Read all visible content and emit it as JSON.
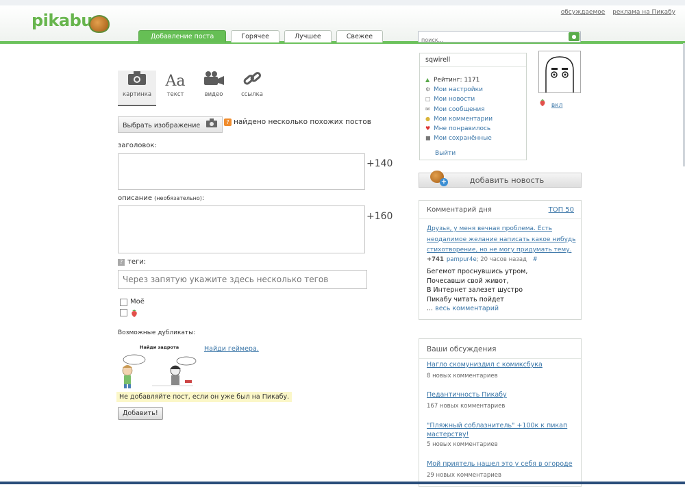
{
  "header": {
    "logo_text": "pikabu",
    "top_links": [
      "обсуждаемое",
      "реклама на Пикабу"
    ],
    "tabs": [
      "Добавление поста",
      "Горячее",
      "Лучшее",
      "Свежее"
    ],
    "search_placeholder": "поиск..."
  },
  "post_form": {
    "type_tabs": [
      {
        "label": "картинка",
        "icon": "camera-icon"
      },
      {
        "label": "текст",
        "icon": "text-icon"
      },
      {
        "label": "видео",
        "icon": "video-camera-icon"
      },
      {
        "label": "ссылка",
        "icon": "link-icon"
      }
    ],
    "choose_image_label": "Выбрать изображение",
    "similar_found": "найдено несколько похожих постов",
    "title_label": "заголовок:",
    "title_counter": "+140",
    "description_label": "описание",
    "description_optional": "(необязательно)",
    "description_colon": ":",
    "description_counter": "+160",
    "tags_label": "теги:",
    "tags_placeholder": "Через запятую укажите здесь несколько тегов",
    "checkbox_mine_label": "Моё",
    "duplicates_label": "Возможные дубликаты:",
    "duplicate_link": "Найди геймера.",
    "comic_caption": "Найди задрота",
    "warning": "Не добавляйте пост, если он уже был на Пикабу.",
    "submit_label": "Добавить!"
  },
  "user": {
    "username": "sqwirell",
    "menu": [
      {
        "icon": "rating-icon",
        "label": "Рейтинг: 1171"
      },
      {
        "icon": "settings-icon",
        "label": "Мои настройки"
      },
      {
        "icon": "news-icon",
        "label": "Мои новости"
      },
      {
        "icon": "mail-icon",
        "label": "Мои сообщения"
      },
      {
        "icon": "comment-icon",
        "label": "Мои комментарии"
      },
      {
        "icon": "heart-icon",
        "label": "Мне понравилось"
      },
      {
        "icon": "save-icon",
        "label": "Мои сохранённые"
      }
    ],
    "logout": "Выйти",
    "strawberry_toggle": "вкл"
  },
  "add_news_label": "добавить новость",
  "comment_of_day": {
    "title": "Комментарий дня",
    "top_link": "ТОП 50",
    "text": "Друзья, у меня вечная проблема. Есть неодалимое желание написать какое нибудь стихотворение, но не могу придумать тему.",
    "score": "+741",
    "author": "pampur4e",
    "time": "; 20 часов назад",
    "hash": "#",
    "poem": [
      "Бегемот проснувшись утром,",
      "Почесавши свой живот,",
      "В Интернет залезет шустро",
      "Пикабу читать пойдет"
    ],
    "more_prefix": "...",
    "more_link": "весь комментарий"
  },
  "discussions": {
    "title": "Ваши обсуждения",
    "items": [
      {
        "title": "Нагло скомуниздил с комиксбука",
        "count": "8 новых комментариев"
      },
      {
        "title": "Педантичность Пикабу",
        "count": "167 новых комментариев"
      },
      {
        "title": "\"Пляжный соблазнитель\" +100к к пикап мастерству!",
        "count": "5 новых комментариев"
      },
      {
        "title": "Мой приятель нашел это у себя в огороде",
        "count": "29 новых комментариев"
      }
    ]
  },
  "colors": {
    "brand_green": "#6cc25c",
    "link_blue": "#3a76a8",
    "orange": "#f08c2d"
  }
}
